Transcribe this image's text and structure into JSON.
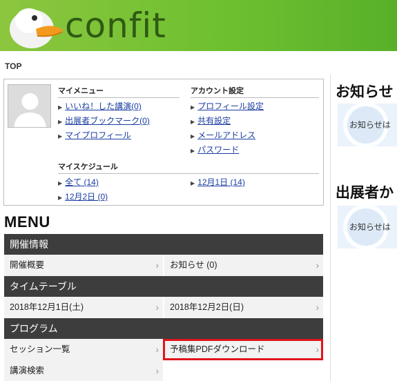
{
  "brand": {
    "logo_text": "confit"
  },
  "breadcrumb": {
    "label": "TOP"
  },
  "my_menu": {
    "title": "マイメニュー",
    "items": [
      {
        "label": "いいね！した講演(0)"
      },
      {
        "label": "出展者ブックマーク(0)"
      },
      {
        "label": "マイプロフィール"
      }
    ]
  },
  "account_settings": {
    "title": "アカウント設定",
    "items": [
      {
        "label": "プロフィール設定"
      },
      {
        "label": "共有設定"
      },
      {
        "label": "メールアドレス"
      },
      {
        "label": "パスワード"
      }
    ]
  },
  "my_schedule": {
    "title": "マイスケジュール",
    "items": [
      {
        "label": "全て (14)"
      },
      {
        "label": "12月1日 (14)"
      },
      {
        "label": "12月2日 (0)"
      }
    ]
  },
  "menu": {
    "title": "MENU",
    "sections": [
      {
        "header": "開催情報",
        "items": [
          "開催概要",
          "お知らせ (0)"
        ]
      },
      {
        "header": "タイムテーブル",
        "items": [
          "2018年12月1日(土)",
          "2018年12月2日(日)"
        ]
      },
      {
        "header": "プログラム",
        "items": [
          "セッション一覧",
          "予稿集PDFダウンロード",
          "講演検索"
        ]
      }
    ]
  },
  "sidebar": {
    "news_title": "お知らせ",
    "news_text": "お知らせは",
    "exhibitor_title": "出展者か",
    "exhibitor_text": "お知らせは"
  },
  "colors": {
    "header_green": "#6cbf2f",
    "section_header": "#3d3d3d",
    "highlight": "#e0151b",
    "link": "#1a3ca0"
  }
}
